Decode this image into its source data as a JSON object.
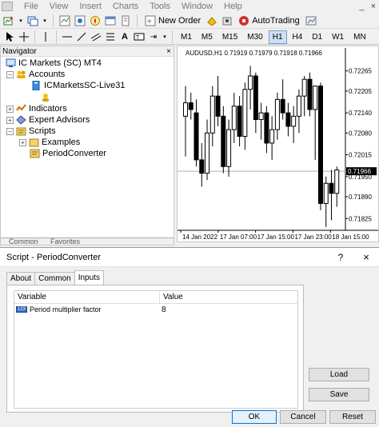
{
  "menu": {
    "items": [
      "File",
      "View",
      "Insert",
      "Charts",
      "Tools",
      "Window",
      "Help"
    ],
    "win_minimize": "_",
    "win_close": "×"
  },
  "toolbar": {
    "new_order": "New Order",
    "autotrading": "AutoTrading"
  },
  "timeframes": [
    "M1",
    "M5",
    "M15",
    "M30",
    "H1",
    "H4",
    "D1",
    "W1",
    "MN"
  ],
  "active_timeframe": "H1",
  "navigator": {
    "title": "Navigator",
    "close": "×",
    "items": [
      {
        "label": "IC Markets (SC) MT4",
        "icon": "terminal-icon"
      },
      {
        "label": "Accounts",
        "icon": "accounts-icon"
      },
      {
        "label": "ICMarketsSC-Live31",
        "icon": "server-icon"
      },
      {
        "label": "Indicators",
        "icon": "indicators-icon"
      },
      {
        "label": "Expert Advisors",
        "icon": "expert-advisors-icon"
      },
      {
        "label": "Scripts",
        "icon": "scripts-icon"
      },
      {
        "label": "Examples",
        "icon": "folder-icon"
      },
      {
        "label": "PeriodConverter",
        "icon": "script-icon"
      }
    ],
    "tabs": [
      "Common",
      "Favorites"
    ]
  },
  "chart_data": {
    "type": "candlestick",
    "title": "AUDUSD,H1  0.71919 0.71979 0.71918 0.71966",
    "y_ticks": [
      "0.72265",
      "0.72205",
      "0.72140",
      "0.72080",
      "0.72015",
      "0.71950",
      "0.71890",
      "0.71825"
    ],
    "ylim": [
      0.7179,
      0.723
    ],
    "current_price": "0.71966",
    "current_price_value": 0.71966,
    "x_ticks": [
      "14 Jan 2022",
      "17 Jan 07:00",
      "17 Jan 15:00",
      "17 Jan 23:00",
      "18 Jan 15:00"
    ],
    "candles": [
      {
        "o": 0.7213,
        "h": 0.7222,
        "l": 0.7201,
        "c": 0.7217
      },
      {
        "o": 0.7217,
        "h": 0.722,
        "l": 0.7212,
        "c": 0.7215
      },
      {
        "o": 0.7214,
        "h": 0.7218,
        "l": 0.7198,
        "c": 0.72
      },
      {
        "o": 0.72,
        "h": 0.7205,
        "l": 0.7192,
        "c": 0.7196
      },
      {
        "o": 0.7196,
        "h": 0.7212,
        "l": 0.7194,
        "c": 0.7208
      },
      {
        "o": 0.7208,
        "h": 0.7222,
        "l": 0.7204,
        "c": 0.7219
      },
      {
        "o": 0.7219,
        "h": 0.7225,
        "l": 0.721,
        "c": 0.7213
      },
      {
        "o": 0.7213,
        "h": 0.7216,
        "l": 0.7196,
        "c": 0.7198
      },
      {
        "o": 0.7198,
        "h": 0.7212,
        "l": 0.7195,
        "c": 0.7209
      },
      {
        "o": 0.7209,
        "h": 0.722,
        "l": 0.7205,
        "c": 0.7216
      },
      {
        "o": 0.7216,
        "h": 0.7219,
        "l": 0.7204,
        "c": 0.7207
      },
      {
        "o": 0.7207,
        "h": 0.7223,
        "l": 0.7203,
        "c": 0.7221
      },
      {
        "o": 0.7221,
        "h": 0.7228,
        "l": 0.7215,
        "c": 0.7225
      },
      {
        "o": 0.7225,
        "h": 0.7226,
        "l": 0.7208,
        "c": 0.7212
      },
      {
        "o": 0.7212,
        "h": 0.7217,
        "l": 0.7206,
        "c": 0.7214
      },
      {
        "o": 0.7214,
        "h": 0.7216,
        "l": 0.7202,
        "c": 0.7205
      },
      {
        "o": 0.7205,
        "h": 0.7213,
        "l": 0.72,
        "c": 0.7209
      },
      {
        "o": 0.7209,
        "h": 0.722,
        "l": 0.7206,
        "c": 0.7218
      },
      {
        "o": 0.7218,
        "h": 0.7224,
        "l": 0.7212,
        "c": 0.7214
      },
      {
        "o": 0.7214,
        "h": 0.7217,
        "l": 0.7207,
        "c": 0.721
      },
      {
        "o": 0.721,
        "h": 0.7216,
        "l": 0.7205,
        "c": 0.7213
      },
      {
        "o": 0.7213,
        "h": 0.7221,
        "l": 0.7208,
        "c": 0.7219
      },
      {
        "o": 0.7219,
        "h": 0.7225,
        "l": 0.7213,
        "c": 0.7224
      },
      {
        "o": 0.7224,
        "h": 0.7226,
        "l": 0.7213,
        "c": 0.7215
      },
      {
        "o": 0.7215,
        "h": 0.7222,
        "l": 0.72,
        "c": 0.7222
      },
      {
        "o": 0.7222,
        "h": 0.7223,
        "l": 0.7185,
        "c": 0.7187
      },
      {
        "o": 0.7187,
        "h": 0.7195,
        "l": 0.718,
        "c": 0.7193
      },
      {
        "o": 0.7193,
        "h": 0.7197,
        "l": 0.7182,
        "c": 0.719
      },
      {
        "o": 0.719,
        "h": 0.7198,
        "l": 0.7186,
        "c": 0.7197
      }
    ]
  },
  "dialog": {
    "title": "Script - PeriodConverter",
    "help": "?",
    "close": "×",
    "tabs": [
      "About",
      "Common",
      "Inputs"
    ],
    "active_tab": "Inputs",
    "columns": [
      "Variable",
      "Value"
    ],
    "rows": [
      {
        "icon": "int-param-icon",
        "icon_text": "123",
        "variable": "Period multiplier factor",
        "value": "8"
      }
    ],
    "buttons": {
      "load": "Load",
      "save": "Save",
      "ok": "OK",
      "cancel": "Cancel",
      "reset": "Reset"
    }
  }
}
